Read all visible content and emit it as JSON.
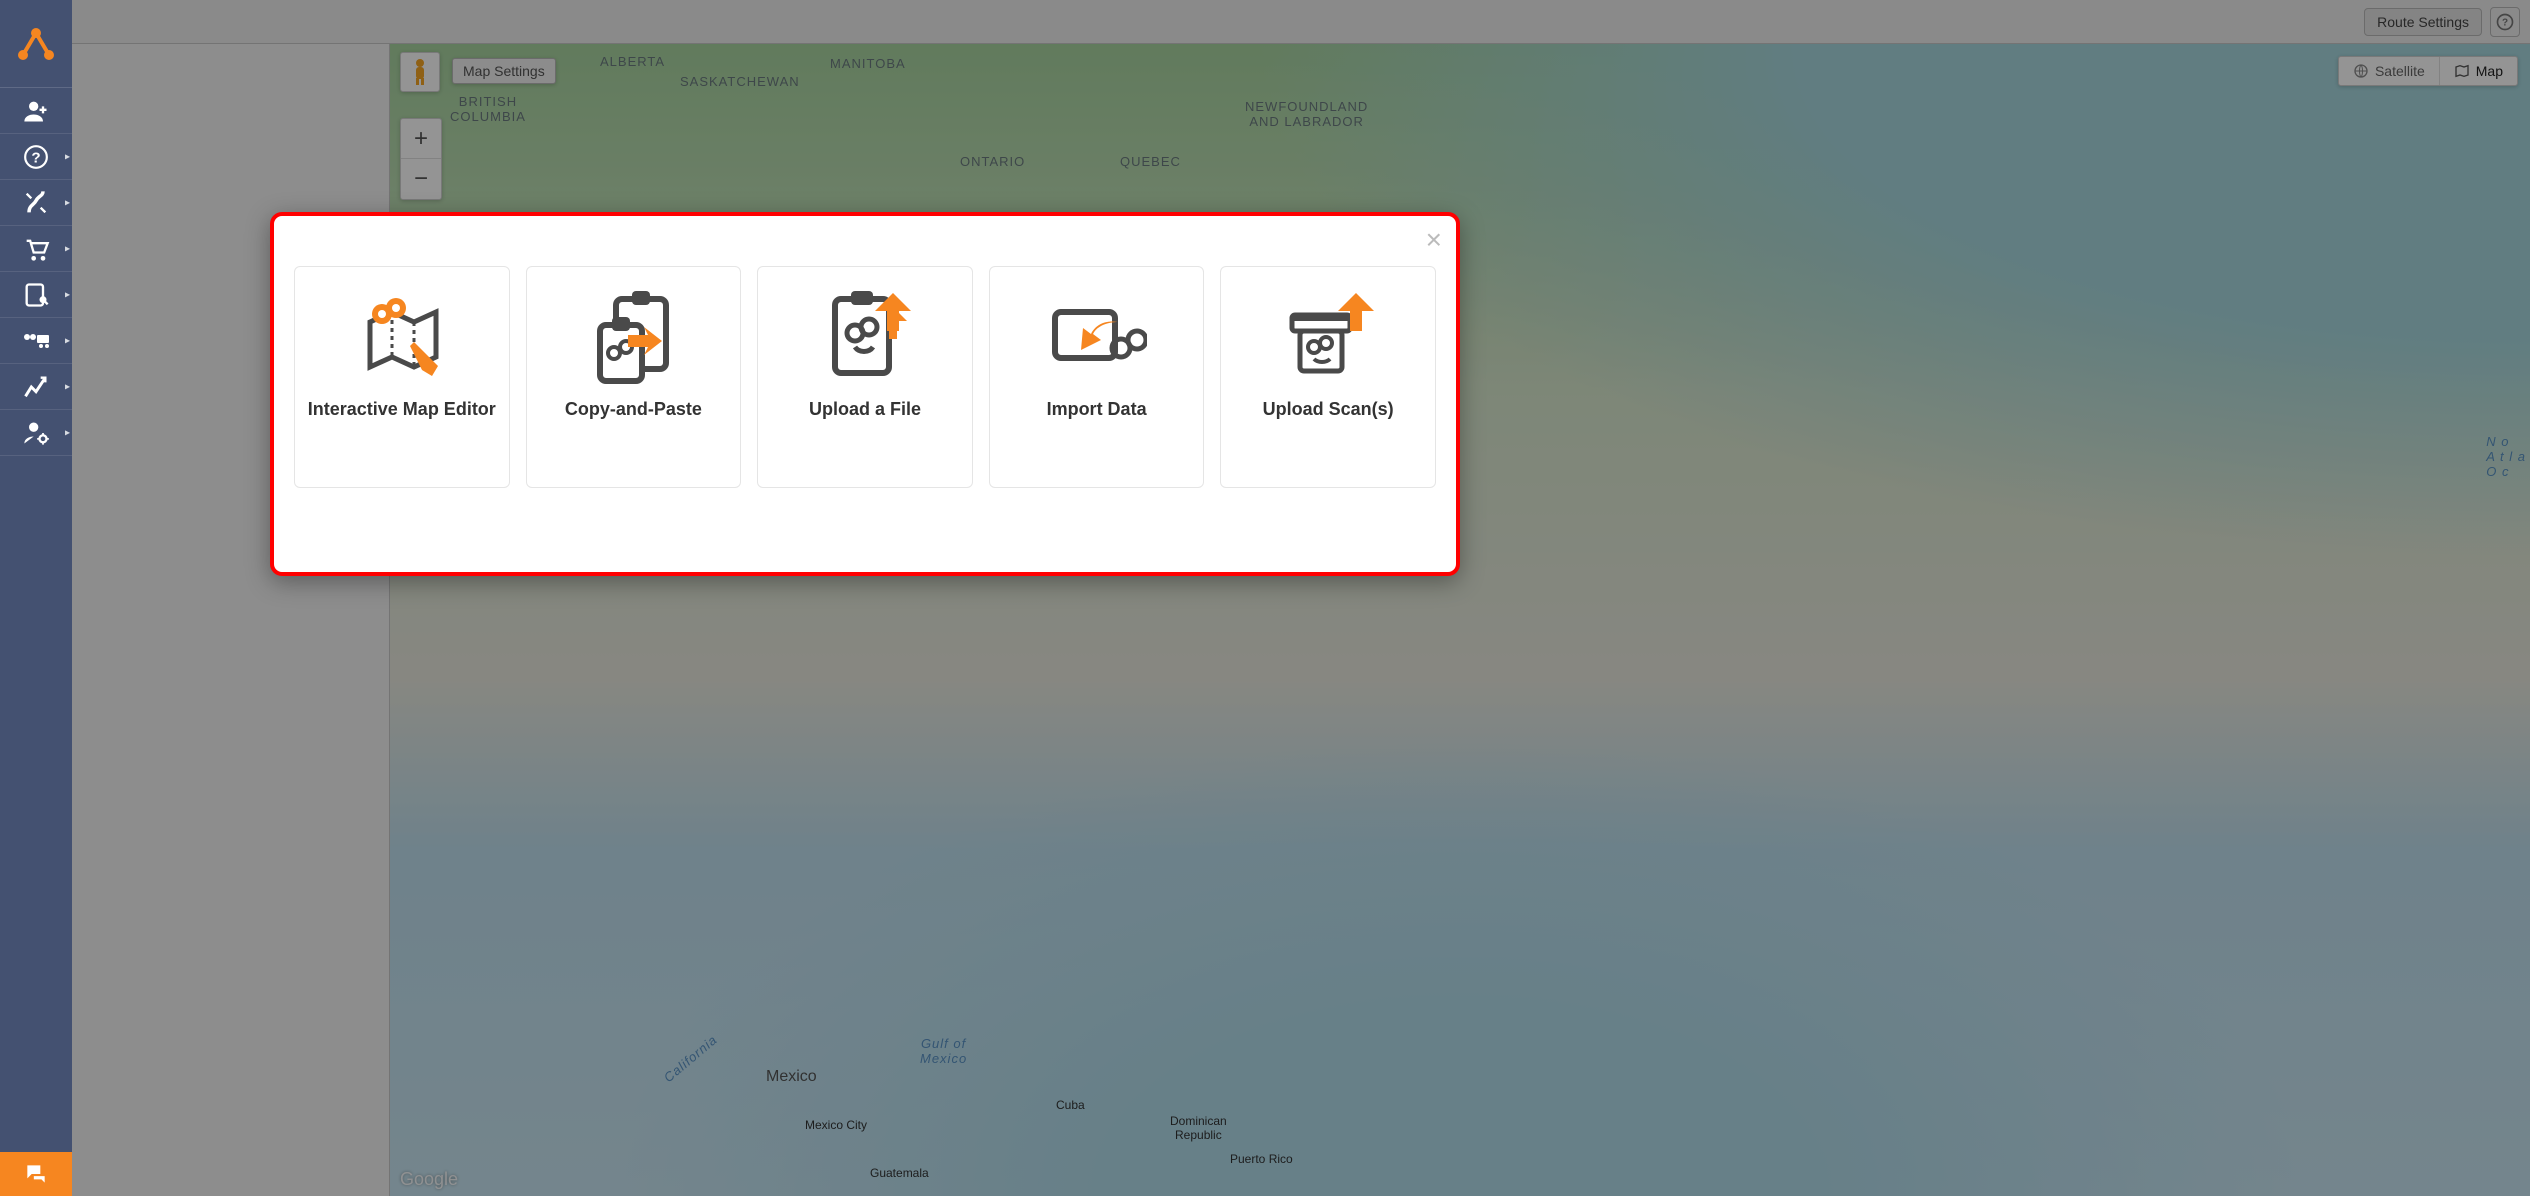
{
  "toolbar": {
    "route_settings": "Route Settings"
  },
  "map": {
    "map_settings": "Map Settings",
    "satellite": "Satellite",
    "map_label": "Map",
    "zoom_in": "+",
    "zoom_out": "−",
    "attribution": "Google",
    "labels": {
      "alberta": "ALBERTA",
      "bc": "BRITISH\nCOLUMBIA",
      "sask": "SASKATCHEWAN",
      "manitoba": "MANITOBA",
      "ontario": "ONTARIO",
      "quebec": "QUEBEC",
      "nl": "NEWFOUNDLAND\nAND LABRADOR",
      "mexico": "Mexico",
      "mexico_city": "Mexico City",
      "guatemala": "Guatemala",
      "cuba": "Cuba",
      "dr": "Dominican\nRepublic",
      "pr": "Puerto Rico",
      "gulf": "Gulf of\nMexico",
      "atlantic": "N o\nA t l a\nO c",
      "california": "California"
    }
  },
  "modal": {
    "cards": [
      {
        "label": "Interactive Map Editor"
      },
      {
        "label": "Copy-and-Paste"
      },
      {
        "label": "Upload a File"
      },
      {
        "label": "Import Data"
      },
      {
        "label": "Upload Scan(s)"
      }
    ]
  }
}
